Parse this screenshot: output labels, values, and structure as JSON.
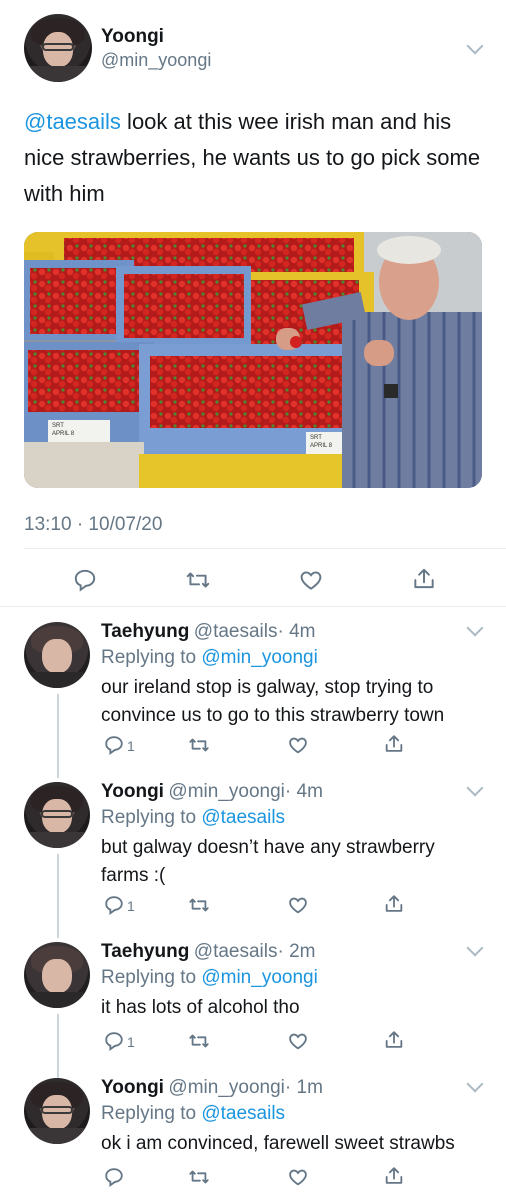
{
  "main_tweet": {
    "name": "Yoongi",
    "handle": "@min_yoongi",
    "mention": "@taesails",
    "text": " look at this wee irish man and his nice strawberries, he wants us to go pick some with him",
    "timestamp": "13:10 · 10/07/20"
  },
  "photo": {
    "crate_label_1": "SRT\nAPRIL 8",
    "crate_label_2": "SRT\nAPRIL 8"
  },
  "replies": [
    {
      "name": "Taehyung",
      "handle": "@taesails",
      "time": "· 4m",
      "replying_prefix": "Replying to ",
      "replying_to": "@min_yoongi",
      "text": "our ireland stop is galway, stop trying to convince us to go to this strawberry town",
      "reply_count": "1"
    },
    {
      "name": "Yoongi",
      "handle": "@min_yoongi",
      "time": "· 4m",
      "replying_prefix": "Replying to ",
      "replying_to": "@taesails",
      "text": "but galway doesn’t have any strawberry farms :(",
      "reply_count": "1"
    },
    {
      "name": "Taehyung",
      "handle": "@taesails",
      "time": "· 2m",
      "replying_prefix": "Replying to ",
      "replying_to": "@min_yoongi",
      "text": "it has lots of alcohol tho",
      "reply_count": "1"
    },
    {
      "name": "Yoongi",
      "handle": "@min_yoongi",
      "time": "· 1m",
      "replying_prefix": "Replying to ",
      "replying_to": "@taesails",
      "text": "ok i am convinced, farewell sweet strawbs",
      "reply_count": ""
    }
  ],
  "colors": {
    "link": "#1b95e0",
    "secondary": "#657786",
    "divider": "#e6ecf0"
  },
  "icons": [
    "reply-icon",
    "retweet-icon",
    "like-icon",
    "share-icon",
    "chevron-down-icon"
  ]
}
